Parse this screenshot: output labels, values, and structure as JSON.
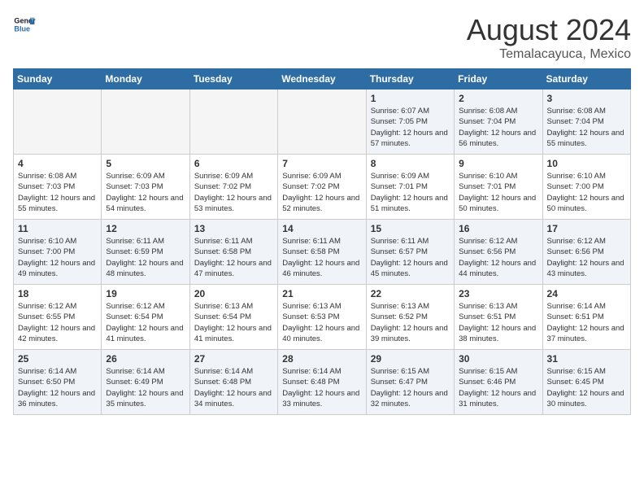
{
  "header": {
    "logo_line1": "General",
    "logo_line2": "Blue",
    "month": "August 2024",
    "location": "Temalacayuca, Mexico"
  },
  "days_of_week": [
    "Sunday",
    "Monday",
    "Tuesday",
    "Wednesday",
    "Thursday",
    "Friday",
    "Saturday"
  ],
  "weeks": [
    [
      {
        "day": "",
        "info": "",
        "empty": true
      },
      {
        "day": "",
        "info": "",
        "empty": true
      },
      {
        "day": "",
        "info": "",
        "empty": true
      },
      {
        "day": "",
        "info": "",
        "empty": true
      },
      {
        "day": "1",
        "info": "Sunrise: 6:07 AM\nSunset: 7:05 PM\nDaylight: 12 hours\nand 57 minutes."
      },
      {
        "day": "2",
        "info": "Sunrise: 6:08 AM\nSunset: 7:04 PM\nDaylight: 12 hours\nand 56 minutes."
      },
      {
        "day": "3",
        "info": "Sunrise: 6:08 AM\nSunset: 7:04 PM\nDaylight: 12 hours\nand 55 minutes."
      }
    ],
    [
      {
        "day": "4",
        "info": "Sunrise: 6:08 AM\nSunset: 7:03 PM\nDaylight: 12 hours\nand 55 minutes."
      },
      {
        "day": "5",
        "info": "Sunrise: 6:09 AM\nSunset: 7:03 PM\nDaylight: 12 hours\nand 54 minutes."
      },
      {
        "day": "6",
        "info": "Sunrise: 6:09 AM\nSunset: 7:02 PM\nDaylight: 12 hours\nand 53 minutes."
      },
      {
        "day": "7",
        "info": "Sunrise: 6:09 AM\nSunset: 7:02 PM\nDaylight: 12 hours\nand 52 minutes."
      },
      {
        "day": "8",
        "info": "Sunrise: 6:09 AM\nSunset: 7:01 PM\nDaylight: 12 hours\nand 51 minutes."
      },
      {
        "day": "9",
        "info": "Sunrise: 6:10 AM\nSunset: 7:01 PM\nDaylight: 12 hours\nand 50 minutes."
      },
      {
        "day": "10",
        "info": "Sunrise: 6:10 AM\nSunset: 7:00 PM\nDaylight: 12 hours\nand 50 minutes."
      }
    ],
    [
      {
        "day": "11",
        "info": "Sunrise: 6:10 AM\nSunset: 7:00 PM\nDaylight: 12 hours\nand 49 minutes."
      },
      {
        "day": "12",
        "info": "Sunrise: 6:11 AM\nSunset: 6:59 PM\nDaylight: 12 hours\nand 48 minutes."
      },
      {
        "day": "13",
        "info": "Sunrise: 6:11 AM\nSunset: 6:58 PM\nDaylight: 12 hours\nand 47 minutes."
      },
      {
        "day": "14",
        "info": "Sunrise: 6:11 AM\nSunset: 6:58 PM\nDaylight: 12 hours\nand 46 minutes."
      },
      {
        "day": "15",
        "info": "Sunrise: 6:11 AM\nSunset: 6:57 PM\nDaylight: 12 hours\nand 45 minutes."
      },
      {
        "day": "16",
        "info": "Sunrise: 6:12 AM\nSunset: 6:56 PM\nDaylight: 12 hours\nand 44 minutes."
      },
      {
        "day": "17",
        "info": "Sunrise: 6:12 AM\nSunset: 6:56 PM\nDaylight: 12 hours\nand 43 minutes."
      }
    ],
    [
      {
        "day": "18",
        "info": "Sunrise: 6:12 AM\nSunset: 6:55 PM\nDaylight: 12 hours\nand 42 minutes."
      },
      {
        "day": "19",
        "info": "Sunrise: 6:12 AM\nSunset: 6:54 PM\nDaylight: 12 hours\nand 41 minutes."
      },
      {
        "day": "20",
        "info": "Sunrise: 6:13 AM\nSunset: 6:54 PM\nDaylight: 12 hours\nand 41 minutes."
      },
      {
        "day": "21",
        "info": "Sunrise: 6:13 AM\nSunset: 6:53 PM\nDaylight: 12 hours\nand 40 minutes."
      },
      {
        "day": "22",
        "info": "Sunrise: 6:13 AM\nSunset: 6:52 PM\nDaylight: 12 hours\nand 39 minutes."
      },
      {
        "day": "23",
        "info": "Sunrise: 6:13 AM\nSunset: 6:51 PM\nDaylight: 12 hours\nand 38 minutes."
      },
      {
        "day": "24",
        "info": "Sunrise: 6:14 AM\nSunset: 6:51 PM\nDaylight: 12 hours\nand 37 minutes."
      }
    ],
    [
      {
        "day": "25",
        "info": "Sunrise: 6:14 AM\nSunset: 6:50 PM\nDaylight: 12 hours\nand 36 minutes."
      },
      {
        "day": "26",
        "info": "Sunrise: 6:14 AM\nSunset: 6:49 PM\nDaylight: 12 hours\nand 35 minutes."
      },
      {
        "day": "27",
        "info": "Sunrise: 6:14 AM\nSunset: 6:48 PM\nDaylight: 12 hours\nand 34 minutes."
      },
      {
        "day": "28",
        "info": "Sunrise: 6:14 AM\nSunset: 6:48 PM\nDaylight: 12 hours\nand 33 minutes."
      },
      {
        "day": "29",
        "info": "Sunrise: 6:15 AM\nSunset: 6:47 PM\nDaylight: 12 hours\nand 32 minutes."
      },
      {
        "day": "30",
        "info": "Sunrise: 6:15 AM\nSunset: 6:46 PM\nDaylight: 12 hours\nand 31 minutes."
      },
      {
        "day": "31",
        "info": "Sunrise: 6:15 AM\nSunset: 6:45 PM\nDaylight: 12 hours\nand 30 minutes."
      }
    ]
  ]
}
